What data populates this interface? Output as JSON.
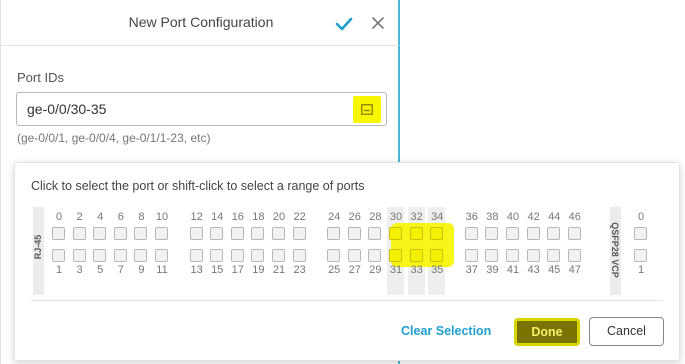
{
  "dialog": {
    "title": "New Port Configuration",
    "port_ids_label": "Port IDs",
    "port_ids_value": "ge-0/0/30-35",
    "port_ids_hint": "(ge-0/0/1, ge-0/0/4, ge-0/1/1-23, etc)",
    "faint_background_text": "",
    "icons": {
      "confirm": "checkmark-icon",
      "close": "close-icon",
      "picker": "port-picker-icon"
    },
    "accent_color": "#1f9fd0",
    "highlight_color": "#f5ef00"
  },
  "panel": {
    "instruction": "Click to select the port or shift-click to select a range of ports",
    "rj45_label": "RJ-45",
    "qsfp_label": "QSFP28 VCP",
    "ports": [
      {
        "n": "0",
        "sel": false
      },
      {
        "n": "1",
        "sel": false
      },
      {
        "n": "2",
        "sel": false
      },
      {
        "n": "3",
        "sel": false
      },
      {
        "n": "4",
        "sel": false
      },
      {
        "n": "5",
        "sel": false
      },
      {
        "n": "6",
        "sel": false
      },
      {
        "n": "7",
        "sel": false
      },
      {
        "n": "8",
        "sel": false
      },
      {
        "n": "9",
        "sel": false
      },
      {
        "n": "10",
        "sel": false
      },
      {
        "n": "11",
        "sel": false
      },
      {
        "n": "12",
        "sel": false
      },
      {
        "n": "13",
        "sel": false
      },
      {
        "n": "14",
        "sel": false
      },
      {
        "n": "15",
        "sel": false
      },
      {
        "n": "16",
        "sel": false
      },
      {
        "n": "17",
        "sel": false
      },
      {
        "n": "18",
        "sel": false
      },
      {
        "n": "19",
        "sel": false
      },
      {
        "n": "20",
        "sel": false
      },
      {
        "n": "21",
        "sel": false
      },
      {
        "n": "22",
        "sel": false
      },
      {
        "n": "23",
        "sel": false
      },
      {
        "n": "24",
        "sel": false
      },
      {
        "n": "25",
        "sel": false
      },
      {
        "n": "26",
        "sel": false
      },
      {
        "n": "27",
        "sel": false
      },
      {
        "n": "28",
        "sel": false
      },
      {
        "n": "29",
        "sel": false
      },
      {
        "n": "30",
        "sel": true
      },
      {
        "n": "31",
        "sel": true
      },
      {
        "n": "32",
        "sel": true
      },
      {
        "n": "33",
        "sel": true
      },
      {
        "n": "34",
        "sel": true
      },
      {
        "n": "35",
        "sel": true
      },
      {
        "n": "36",
        "sel": false
      },
      {
        "n": "37",
        "sel": false
      },
      {
        "n": "38",
        "sel": false
      },
      {
        "n": "39",
        "sel": false
      },
      {
        "n": "40",
        "sel": false
      },
      {
        "n": "41",
        "sel": false
      },
      {
        "n": "42",
        "sel": false
      },
      {
        "n": "43",
        "sel": false
      },
      {
        "n": "44",
        "sel": false
      },
      {
        "n": "45",
        "sel": false
      },
      {
        "n": "46",
        "sel": false
      },
      {
        "n": "47",
        "sel": false
      }
    ],
    "vcp_ports": [
      {
        "n": "0",
        "sel": false
      },
      {
        "n": "1",
        "sel": false
      }
    ],
    "clear_label": "Clear Selection",
    "done_label": "Done",
    "cancel_label": "Cancel"
  }
}
